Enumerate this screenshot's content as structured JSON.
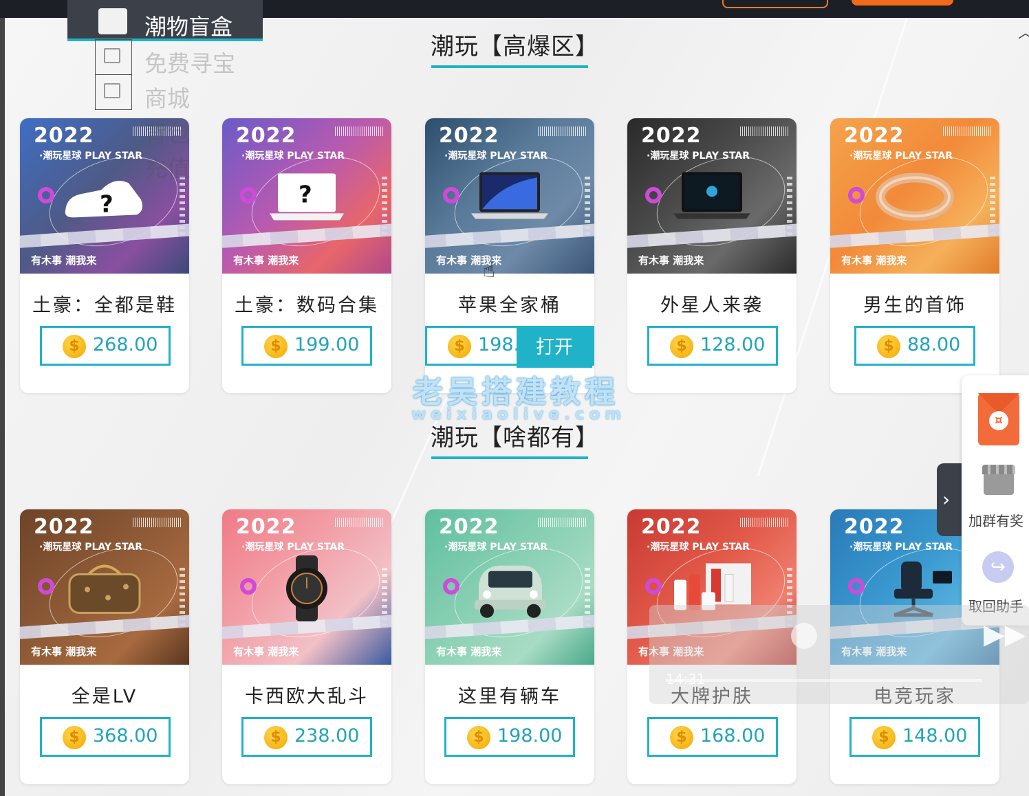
{
  "menu": {
    "header_label": "潮物盲盒",
    "items": [
      {
        "label": "免费寻宝"
      },
      {
        "label": "商城"
      },
      {
        "label": "背包"
      },
      {
        "label": "充值"
      }
    ]
  },
  "sections": [
    {
      "title": "潮玩【高爆区】",
      "cards": [
        {
          "name": "土豪：全都是鞋",
          "price": "268.00"
        },
        {
          "name": "土豪：数码合集",
          "price": "199.00"
        },
        {
          "name": "苹果全家桶",
          "price": "198.0",
          "hover_button": "打开"
        },
        {
          "name": "外星人来袭",
          "price": "128.00"
        },
        {
          "name": "男生的首饰",
          "price": "88.00"
        }
      ]
    },
    {
      "title": "潮玩【啥都有】",
      "cards": [
        {
          "name": "全是LV",
          "price": "368.00"
        },
        {
          "name": "卡西欧大乱斗",
          "price": "238.00"
        },
        {
          "name": "这里有辆车",
          "price": "198.00"
        },
        {
          "name": "大牌护肤",
          "price": "168.00"
        },
        {
          "name": "电竞玩家",
          "price": "148.00"
        }
      ]
    }
  ],
  "card_art": {
    "year": "2022",
    "subtitle": "·潮玩星球 PLAY STAR",
    "footer": "有木事 潮我来"
  },
  "coin_symbol": "$",
  "side_panel": {
    "group_label": "加群有奖",
    "retrieve_label": "取回助手"
  },
  "video": {
    "time": "14:31"
  },
  "watermark": {
    "cn": "老吴搭建教程",
    "en": "weixiaolive.com"
  },
  "colors": {
    "accent": "#20b2c9",
    "orange": "#f26b1d",
    "dark": "#3c4049"
  }
}
